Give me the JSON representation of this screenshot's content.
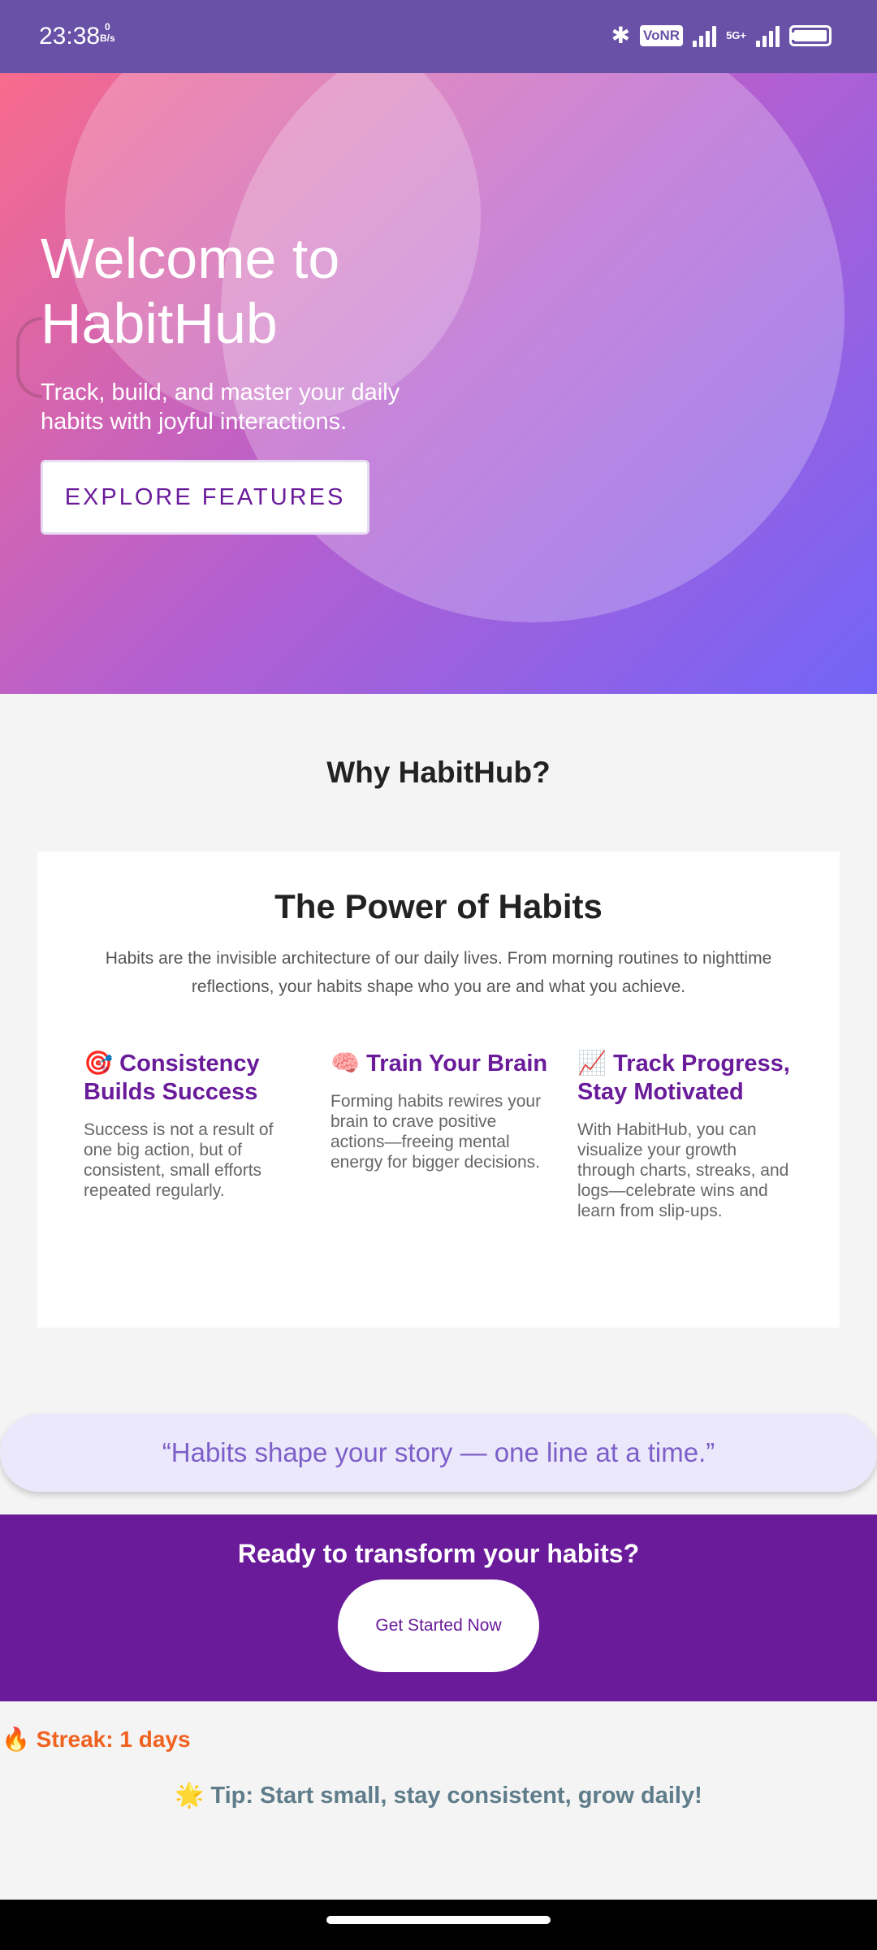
{
  "status_bar": {
    "time": "23:38",
    "net_speed_value": "0",
    "net_speed_unit": "B/s",
    "vonr": "VoNR",
    "network": "5G+",
    "icons": [
      "bluetooth-icon",
      "signal-icon",
      "battery-icon"
    ]
  },
  "hero": {
    "title_line1": "Welcome to",
    "title_line2": "HabitHub",
    "subtitle": "Track, build, and master your daily habits with joyful interactions.",
    "button_label": "EXPLORE FEATURES",
    "gradient": [
      "#f86b8c",
      "#b45fd0",
      "#7364f7"
    ]
  },
  "why": {
    "title": "Why HabitHub?",
    "card_title": "The Power of Habits",
    "card_desc": "Habits are the invisible architecture of our daily lives. From morning routines to nighttime reflections, your habits shape who you are and what you achieve.",
    "features": [
      {
        "icon": "🎯",
        "title": "Consistency Builds Success",
        "text": "Success is not a result of one big action, but of consistent, small efforts repeated regularly."
      },
      {
        "icon": "🧠",
        "title": "Train Your Brain",
        "text": "Forming habits rewires your brain to crave positive actions—freeing mental energy for bigger decisions."
      },
      {
        "icon": "📈",
        "title": "Track Progress, Stay Motivated",
        "text": "With HabitHub, you can visualize your growth through charts, streaks, and logs—celebrate wins and learn from slip-ups."
      }
    ]
  },
  "quote": "“Habits shape your story — one line at a time.”",
  "cta": {
    "title": "Ready to transform your habits?",
    "button_label": "Get Started Now",
    "color": "#6a1b9a"
  },
  "streak": "🔥 Streak: 1 days",
  "tip": "🌟 Tip: Start small, stay consistent, grow daily!"
}
